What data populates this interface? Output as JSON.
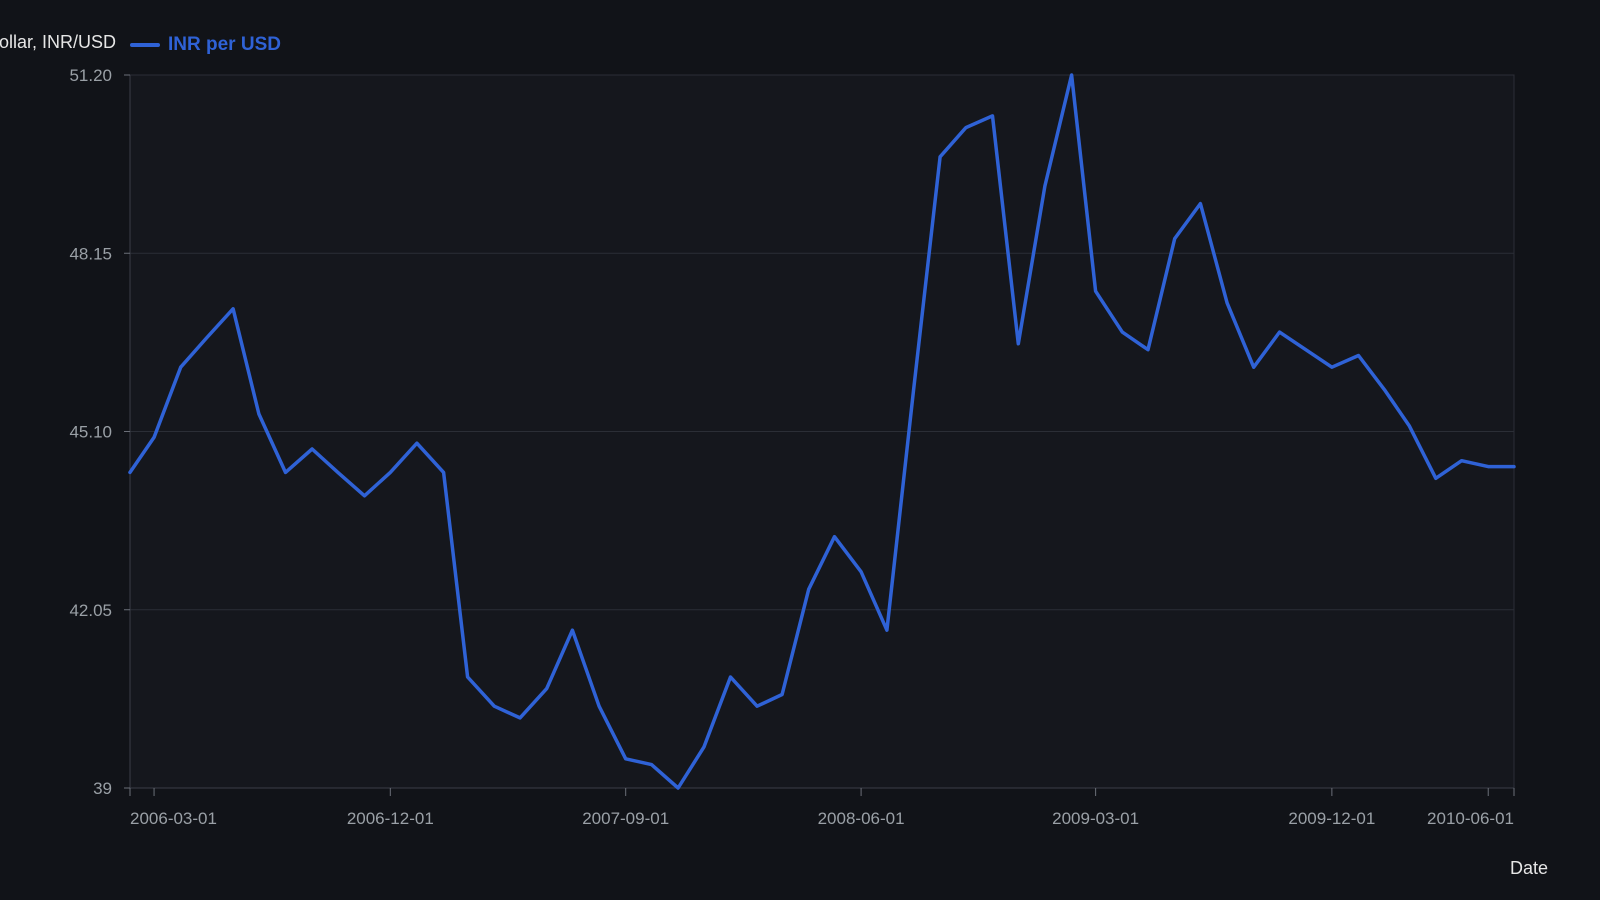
{
  "chart_data": {
    "type": "line",
    "title": "",
    "ylabel": "Indian Rupees to One U.S. Dollar, INR/USD",
    "xlabel": "Date",
    "ylim": [
      39,
      51.2
    ],
    "yticks": [
      "51.20",
      "48.15",
      "45.10",
      "42.05",
      "39"
    ],
    "yticks_values": [
      51.2,
      48.15,
      45.1,
      42.05,
      39
    ],
    "xticks": [
      "2006-03-01",
      "2006-12-01",
      "2007-09-01",
      "2008-06-01",
      "2009-03-01",
      "2009-12-01",
      "2010-06-01"
    ],
    "xlim": [
      "2006-02-01",
      "2010-07-01"
    ],
    "grid": true,
    "legend_position": "top-left",
    "series": [
      {
        "name": "INR per USD",
        "color": "#2f62d6",
        "x": [
          "2006-02-01",
          "2006-03-01",
          "2006-04-01",
          "2006-05-01",
          "2006-06-01",
          "2006-07-01",
          "2006-08-01",
          "2006-09-01",
          "2006-10-01",
          "2006-11-01",
          "2006-12-01",
          "2007-01-01",
          "2007-02-01",
          "2007-03-01",
          "2007-04-01",
          "2007-05-01",
          "2007-06-01",
          "2007-07-01",
          "2007-08-01",
          "2007-09-01",
          "2007-10-01",
          "2007-11-01",
          "2007-12-01",
          "2008-01-01",
          "2008-02-01",
          "2008-03-01",
          "2008-04-01",
          "2008-05-01",
          "2008-06-01",
          "2008-07-01",
          "2008-08-01",
          "2008-09-01",
          "2008-10-01",
          "2008-11-01",
          "2008-12-01",
          "2009-01-01",
          "2009-02-01",
          "2009-03-01",
          "2009-04-01",
          "2009-05-01",
          "2009-06-01",
          "2009-07-01",
          "2009-08-01",
          "2009-09-01",
          "2009-10-01",
          "2009-12-01",
          "2010-01-01",
          "2010-02-01",
          "2010-03-01",
          "2010-04-01",
          "2010-05-01",
          "2010-06-01",
          "2010-07-01"
        ],
        "values": [
          44.4,
          45.0,
          46.2,
          46.7,
          47.2,
          45.4,
          44.4,
          44.8,
          44.4,
          44.0,
          44.4,
          44.9,
          44.4,
          40.9,
          40.4,
          40.2,
          40.7,
          41.7,
          40.4,
          39.5,
          39.4,
          39.0,
          39.7,
          40.9,
          40.4,
          40.6,
          42.4,
          43.3,
          42.7,
          41.7,
          45.8,
          49.8,
          50.3,
          50.5,
          46.6,
          49.3,
          51.2,
          47.5,
          46.8,
          46.5,
          48.4,
          49.0,
          47.3,
          46.2,
          46.8,
          46.2,
          46.4,
          45.8,
          45.2,
          44.3,
          44.6,
          44.5,
          44.5
        ]
      }
    ]
  }
}
